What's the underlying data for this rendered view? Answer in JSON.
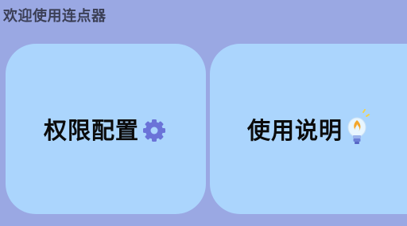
{
  "header": {
    "title": "欢迎使用连点器"
  },
  "cards": [
    {
      "label": "权限配置",
      "icon": "gear-icon"
    },
    {
      "label": "使用说明",
      "icon": "lightbulb-icon"
    }
  ],
  "colors": {
    "background": "#9aa8e3",
    "card": "#abd5fd",
    "gear": "#6b73d8",
    "bulb_flame": "#f4a62a",
    "bulb_glass": "#e8f6ff",
    "bulb_base": "#6b7fd6"
  }
}
